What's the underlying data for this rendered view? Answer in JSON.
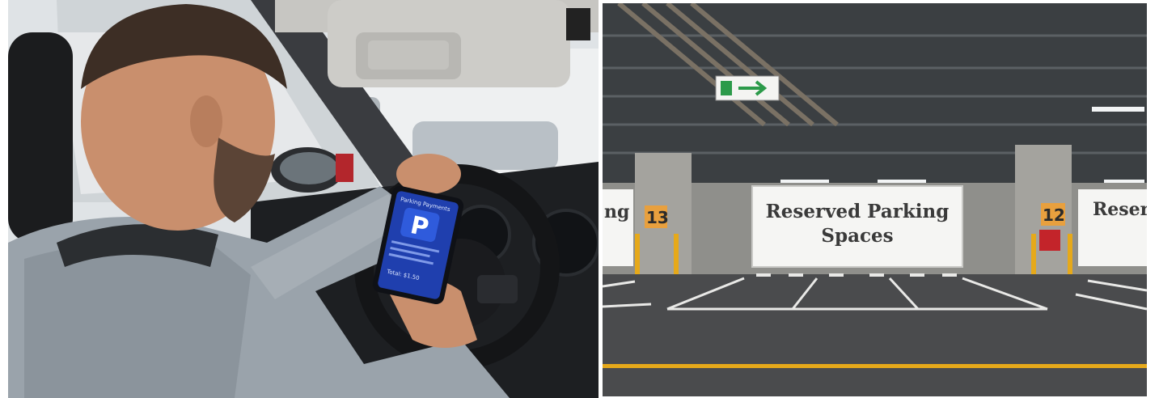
{
  "left_photo": {
    "phone": {
      "app_title": "Parking Payments",
      "parking_symbol": "P",
      "total": "Total: $1.50"
    }
  },
  "right_photo": {
    "main_sign_line1": "Reserved Parking",
    "main_sign_line2": "Spaces",
    "left_sign_partial": "ng",
    "right_sign_partial": "Reser",
    "pillar_left_number": "13",
    "pillar_right_number": "12"
  },
  "colors": {
    "sky": "#dfe3e6",
    "dashboard": "#1d1f22",
    "hoodie": "#9aa3ab",
    "skin": "#c98f6d",
    "phone_screen": "#1f3fae",
    "garage_ceiling": "#3b3f42",
    "garage_floor": "#4a4b4d",
    "yellow_line": "#e6a91a"
  }
}
